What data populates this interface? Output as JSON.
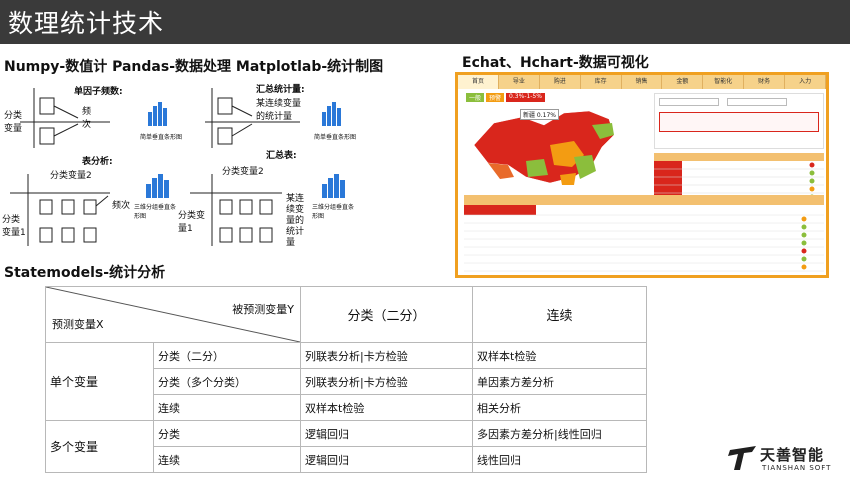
{
  "slide": {
    "title": "数理统计技术"
  },
  "sections": {
    "numpy_heading": "Numpy-数值计  Pandas-数据处理  Matplotlab-统计制图",
    "echart_heading": "Echat、Hchart-数据可视化",
    "statemodels_heading": "Statemodels-统计分析"
  },
  "diagram": {
    "single_factor": "单因子频数:",
    "summary_stat": "汇总统计量:",
    "table_analysis": "表分析:",
    "summary_table": "汇总表:",
    "category_var": "分类\n变量",
    "freq": "频\n次",
    "bar_single": "简单垂直条形图",
    "some_cont_var": "某连续变量\n的统计量",
    "bar_single_2": "简单垂直条形图",
    "cat_var2": "分类变量2",
    "freq2": "频次",
    "cat_var1": "分类\n变量1",
    "bar_3d": "三维分组垂直条\n形图",
    "cat_var2b": "分类变量2",
    "cat_var1b": "分类变\n量1",
    "some_cont_var_b": "某连\n续变\n量的\n统计\n量",
    "bar_3d_b": "三维分组垂直条\n形图"
  },
  "echart": {
    "tabs": [
      "首页",
      "导业",
      "购进",
      "库存",
      "销售",
      "金额",
      "智能化",
      "财务",
      "入力"
    ],
    "legend_items": [
      "一般",
      "预警",
      "0.3%-1-5%"
    ],
    "region_label": "新疆 0.17%",
    "colors": {
      "red": "#d9261c",
      "orange": "#f39c12",
      "green": "#8bbe3c",
      "frame": "#f0a020"
    }
  },
  "stats_table": {
    "header": {
      "predicted_var": "被预测变量Y",
      "predictor_var": "预测变量X",
      "col_binary": "分类（二分）",
      "col_continuous": "连续"
    },
    "groups": [
      {
        "name": "单个变量",
        "rows": [
          {
            "x_type": "分类（二分）",
            "binary": "列联表分析|卡方检验",
            "continuous": "双样本t检验"
          },
          {
            "x_type": "分类（多个分类）",
            "binary": "列联表分析|卡方检验",
            "continuous": "单因素方差分析"
          },
          {
            "x_type": "连续",
            "binary": "双样本t检验",
            "continuous": "相关分析"
          }
        ]
      },
      {
        "name": "多个变量",
        "rows": [
          {
            "x_type": "分类",
            "binary": "逻辑回归",
            "continuous": "多因素方差分析|线性回归"
          },
          {
            "x_type": "连续",
            "binary": "逻辑回归",
            "continuous": "线性回归"
          }
        ]
      }
    ]
  },
  "logo": {
    "cn": "天善智能",
    "en": "TIANSHAN SOFT"
  }
}
